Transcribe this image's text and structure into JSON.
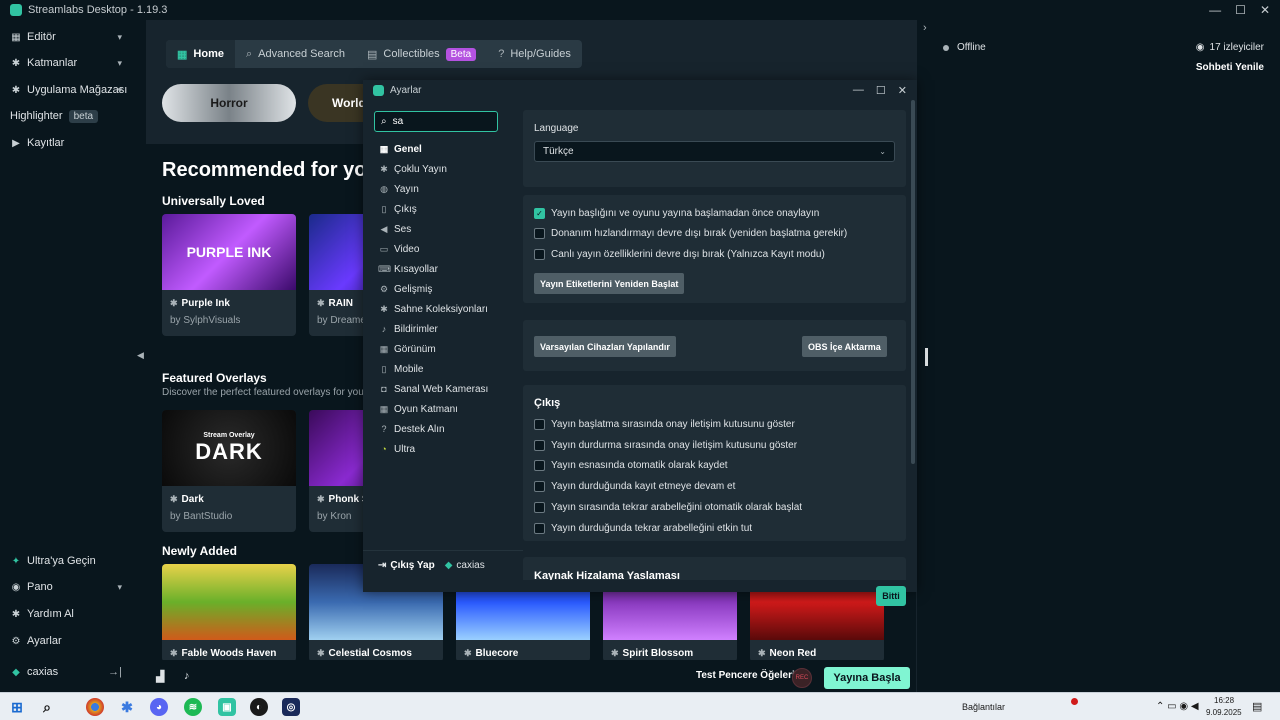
{
  "window": {
    "title": "Streamlabs Desktop - 1.19.3"
  },
  "nav": {
    "editor": "Editör",
    "layers": "Katmanlar",
    "app_store": "Uygulama Mağazası",
    "highlighter": "Highlighter",
    "highlighter_badge": "beta",
    "recordings": "Kayıtlar",
    "ultra": "Ultra'ya Geçin",
    "dashboard": "Pano",
    "help": "Yardım Al",
    "settings": "Ayarlar",
    "user": "caxias"
  },
  "topbar": {
    "home": "Home",
    "advanced_search": "Advanced Search",
    "collectibles": "Collectibles",
    "collectibles_badge": "Beta",
    "help": "Help/Guides"
  },
  "pills": {
    "horror": "Horror",
    "world": "World"
  },
  "main": {
    "recommended": "Recommended for you",
    "universally_loved": "Universally Loved",
    "featured": "Featured Overlays",
    "featured_sub": "Discover the perfect featured overlays for your st",
    "newly_added": "Newly Added"
  },
  "cards": {
    "loved": [
      {
        "thumb": "PURPLE INK",
        "name": "Purple Ink",
        "by": "by SylphVisuals"
      },
      {
        "thumb": "",
        "name": "RAIN",
        "by": "by Dreame"
      }
    ],
    "featured": [
      {
        "thumb": "DARK",
        "thumb_small": "Stream Overlay",
        "name": "Dark",
        "by": "by BantStudio"
      },
      {
        "thumb": "",
        "name": "Phonk S",
        "by": "by Kron"
      }
    ],
    "new": [
      {
        "name": "Fable Woods Haven"
      },
      {
        "name": "Celestial Cosmos"
      },
      {
        "name": "Bluecore"
      },
      {
        "name": "Spirit Blossom"
      },
      {
        "name": "Neon Red"
      }
    ]
  },
  "right": {
    "status": "Offline",
    "viewers": "17 izleyiciler",
    "refresh_chat": "Sohbeti Yenile"
  },
  "status": {
    "test_windows": "Test Pencere Öğeleri",
    "rec": "REC",
    "go_live": "Yayına Başla"
  },
  "dialog": {
    "title": "Ayarlar",
    "search_value": "sa",
    "categories": [
      "Genel",
      "Çoklu Yayın",
      "Yayın",
      "Çıkış",
      "Ses",
      "Video",
      "Kısayollar",
      "Gelişmiş",
      "Sahne Koleksiyonları",
      "Bildirimler",
      "Görünüm",
      "Mobile",
      "Sanal Web Kamerası",
      "Oyun Katmanı",
      "Destek Alın",
      "Ultra"
    ],
    "logout": "Çıkış Yap",
    "user": "caxias",
    "language_label": "Language",
    "language_value": "Türkçe",
    "checks1": [
      {
        "label": "Yayın başlığını ve oyunu yayına başlamadan önce onaylayın",
        "checked": true
      },
      {
        "label": "Donanım hızlandırmayı devre dışı bırak (yeniden başlatma gerekir)",
        "checked": false
      },
      {
        "label": "Canlı yayın özelliklerini devre dışı bırak (Yalnızca Kayıt modu)",
        "checked": false
      }
    ],
    "restart_tags": "Yayın Etiketlerini Yeniden Başlat",
    "default_devices": "Varsayılan Cihazları Yapılandır",
    "obs_import": "OBS İçe Aktarma",
    "output_title": "Çıkış",
    "checks2": [
      "Yayın başlatma sırasında onay iletişim kutusunu göster",
      "Yayın durdurma sırasında onay iletişim kutusunu göster",
      "Yayın esnasında otomatik olarak kaydet",
      "Yayın durduğunda kayıt etmeye devam et",
      "Yayın sırasında tekrar arabelleğini otomatik olarak başlat",
      "Yayın durduğunda tekrar arabelleğini etkin tut"
    ],
    "snap_title": "Kaynak Hizalama Yaslaması",
    "done": "Bitti"
  },
  "taskbar": {
    "connections": "Bağlantılar",
    "time": "16:28",
    "date": "9.09.2025"
  }
}
